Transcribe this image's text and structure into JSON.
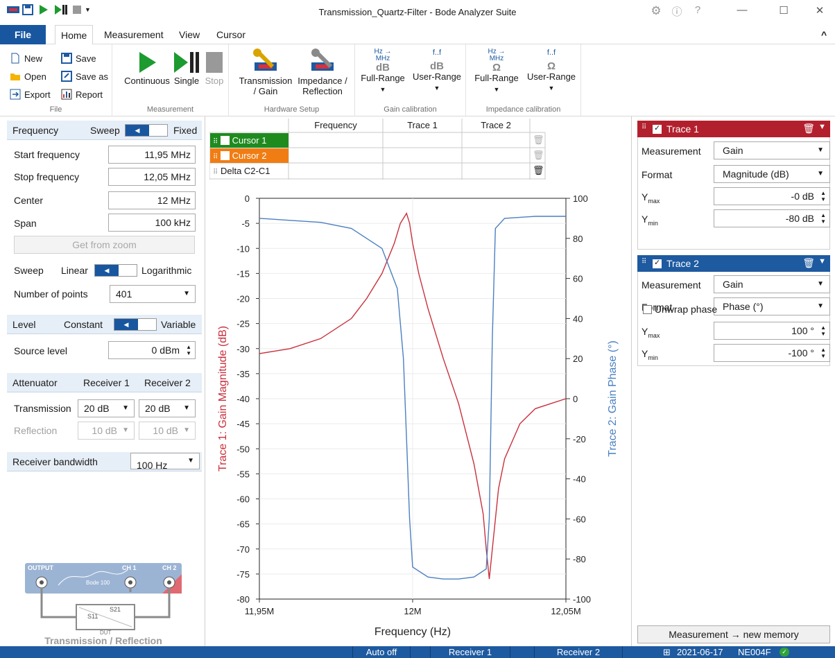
{
  "window": {
    "title": "Transmission_Quartz-Filter - Bode Analyzer Suite",
    "minimize": "—",
    "maximize": "☐",
    "close": "✕",
    "settings_icon": "gear-icon",
    "info_icon": "info-icon",
    "help_icon": "help-icon"
  },
  "tabs": {
    "file": "File",
    "home": "Home",
    "measurement": "Measurement",
    "view": "View",
    "cursor": "Cursor",
    "collapse": "^"
  },
  "ribbon": {
    "file_group": {
      "label": "File",
      "new": "New",
      "save": "Save",
      "open": "Open",
      "save_as": "Save as",
      "export": "Export",
      "report": "Report"
    },
    "measurement_group": {
      "label": "Measurement",
      "continuous": "Continuous",
      "single": "Single",
      "stop": "Stop"
    },
    "hardware_group": {
      "label": "Hardware Setup",
      "transmission_1": "Transmission",
      "transmission_2": "/ Gain",
      "impedance_1": "Impedance /",
      "impedance_2": "Reflection"
    },
    "gain_cal": {
      "label": "Gain calibration",
      "full_range": "Full-Range",
      "user_range": "User-Range",
      "unit": "dB",
      "hz": "Hz",
      "mhz": "MHz",
      "f_range": "f..f"
    },
    "imp_cal": {
      "label": "Impedance calibration",
      "full_range": "Full-Range",
      "user_range": "User-Range",
      "unit": "Ω",
      "hz": "Hz",
      "mhz": "MHz",
      "f_range": "f..f"
    }
  },
  "left": {
    "frequency": {
      "title": "Frequency",
      "sweep": "Sweep",
      "fixed": "Fixed"
    },
    "start_label": "Start frequency",
    "start_value": "11,95 MHz",
    "stop_label": "Stop frequency",
    "stop_value": "12,05 MHz",
    "center_label": "Center",
    "center_value": "12 MHz",
    "span_label": "Span",
    "span_value": "100 kHz",
    "get_from_zoom": "Get from zoom",
    "sweep_label": "Sweep",
    "sweep_linear": "Linear",
    "sweep_log": "Logarithmic",
    "points_label": "Number of points",
    "points_value": "401",
    "level": {
      "title": "Level",
      "constant": "Constant",
      "variable": "Variable"
    },
    "source_label": "Source level",
    "source_value": "0 dBm",
    "attenuator": {
      "title": "Attenuator",
      "r1": "Receiver 1",
      "r2": "Receiver 2"
    },
    "transmission_label": "Transmission",
    "trans_r1": "20 dB",
    "trans_r2": "20 dB",
    "reflection_label": "Reflection",
    "refl_r1": "10 dB",
    "refl_r2": "10 dB",
    "rbw_label": "Receiver bandwidth",
    "rbw_value": "100 Hz",
    "diagram": {
      "output": "OUTPUT",
      "ch1": "CH 1",
      "ch2": "CH 2",
      "bode": "Bode 100",
      "dut": "DUT",
      "s11": "S11",
      "s21": "S21",
      "caption": "Transmission / Reflection"
    }
  },
  "cursor_table": {
    "headers": [
      "Frequency",
      "Trace 1",
      "Trace 2"
    ],
    "rows": [
      {
        "name": "Cursor 1",
        "color": "#1f8b1f"
      },
      {
        "name": "Cursor 2",
        "color": "#f07d14"
      },
      {
        "name": "Delta C2-C1",
        "color": ""
      }
    ]
  },
  "chart_data": {
    "type": "line",
    "xlabel": "Frequency (Hz)",
    "ylabel": "Trace 1: Gain Magnitude (dB)",
    "y2label": "Trace 2: Gain Phase (°)",
    "xlim": [
      11.95,
      12.05
    ],
    "ylim": [
      -80,
      0
    ],
    "y2lim": [
      -100,
      100
    ],
    "x_ticks": [
      "11,95M",
      "12M",
      "12,05M"
    ],
    "y_ticks": [
      "0",
      "-5",
      "-10",
      "-15",
      "-20",
      "-25",
      "-30",
      "-35",
      "-40",
      "-45",
      "-50",
      "-55",
      "-60",
      "-65",
      "-70",
      "-75",
      "-80"
    ],
    "y2_ticks": [
      "100",
      "80",
      "60",
      "40",
      "20",
      "0",
      "-20",
      "-40",
      "-60",
      "-80",
      "-100"
    ],
    "grid": true,
    "series": [
      {
        "name": "Trace 1",
        "axis": "left",
        "color": "#c8303c",
        "x": [
          11.95,
          11.96,
          11.97,
          11.98,
          11.985,
          11.99,
          11.994,
          11.996,
          11.998,
          11.999,
          12.0,
          12.002,
          12.005,
          12.01,
          12.015,
          12.02,
          12.023,
          12.024,
          12.025,
          12.026,
          12.028,
          12.03,
          12.035,
          12.04,
          12.045,
          12.05
        ],
        "values": [
          -31,
          -30,
          -28,
          -24,
          -20,
          -15,
          -9,
          -5,
          -3,
          -5,
          -9,
          -15,
          -22,
          -32,
          -41,
          -53,
          -63,
          -70,
          -76,
          -70,
          -58,
          -52,
          -45,
          -42,
          -41,
          -40
        ]
      },
      {
        "name": "Trace 2",
        "axis": "right",
        "color": "#4a7fc1",
        "x": [
          11.95,
          11.96,
          11.97,
          11.98,
          11.99,
          11.995,
          11.997,
          11.998,
          11.999,
          12.0,
          12.005,
          12.01,
          12.015,
          12.02,
          12.024,
          12.025,
          12.026,
          12.027,
          12.03,
          12.04,
          12.05
        ],
        "values": [
          90,
          89,
          88,
          85,
          75,
          55,
          20,
          -20,
          -60,
          -84,
          -89,
          -90,
          -90,
          -89,
          -85,
          -60,
          30,
          85,
          90,
          91,
          91
        ]
      }
    ]
  },
  "right": {
    "trace1": {
      "name": "Trace 1",
      "color": "#b3202d",
      "measurement_label": "Measurement",
      "measurement": "Gain",
      "format_label": "Format",
      "format": "Magnitude (dB)",
      "ymax_label": "Y",
      "ymax_sub": "max",
      "ymax": "-0 dB",
      "ymin_label": "Y",
      "ymin_sub": "min",
      "ymin": "-80 dB"
    },
    "trace2": {
      "name": "Trace 2",
      "color": "#1e5aa0",
      "measurement_label": "Measurement",
      "measurement": "Gain",
      "format_label": "Format",
      "format": "Phase (°)",
      "unwrap": "Unwrap phase",
      "ymax_label": "Y",
      "ymax_sub": "max",
      "ymax": "100 °",
      "ymin_label": "Y",
      "ymin_sub": "min",
      "ymin": "-100 °"
    },
    "new_memory": "Measurement → new memory"
  },
  "status": {
    "auto_off": "Auto off",
    "receiver1": "Receiver 1",
    "receiver2": "Receiver 2",
    "date": "2021-06-17",
    "device": "NE004F"
  }
}
